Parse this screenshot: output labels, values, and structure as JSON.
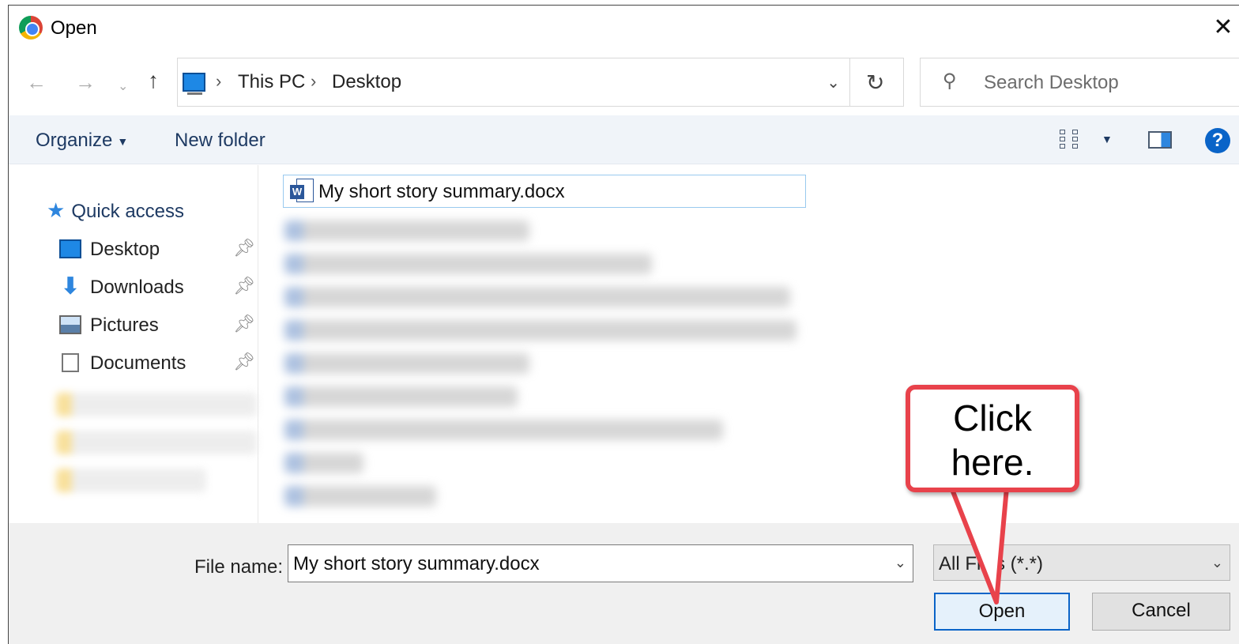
{
  "window": {
    "title": "Open",
    "close_label": "✕"
  },
  "nav": {
    "back_label": "←",
    "forward_label": "→",
    "recent_label": "⌄",
    "up_label": "↑",
    "breadcrumbs": [
      "This PC",
      "Desktop"
    ],
    "breadcrumb_separator": "›",
    "dropdown_label": "⌄",
    "refresh_label": "↻",
    "search_placeholder": "Search Desktop"
  },
  "toolbar": {
    "organize_label": "Organize",
    "new_folder_label": "New folder",
    "help_label": "?"
  },
  "sidebar": {
    "quick_access_label": "Quick access",
    "items": [
      {
        "label": "Desktop",
        "icon": "desktop-icon",
        "pinned": true
      },
      {
        "label": "Downloads",
        "icon": "downloads-icon",
        "pinned": true
      },
      {
        "label": "Pictures",
        "icon": "pictures-icon",
        "pinned": true
      },
      {
        "label": "Documents",
        "icon": "documents-icon",
        "pinned": true
      }
    ]
  },
  "files": {
    "selected_file": "My short story summary.docx",
    "selected_icon": "word-document-icon"
  },
  "footer": {
    "file_name_label": "File name:",
    "file_name_value": "My short story summary.docx",
    "file_type_value": "All Files (*.*)",
    "open_label": "Open",
    "cancel_label": "Cancel"
  },
  "annotation": {
    "callout_text": "Click\nhere.",
    "border_color": "#e8424b"
  },
  "colors": {
    "accent": "#0a64c8",
    "toolbar_text": "#1e3a63",
    "selection_border": "#99c9ef"
  }
}
